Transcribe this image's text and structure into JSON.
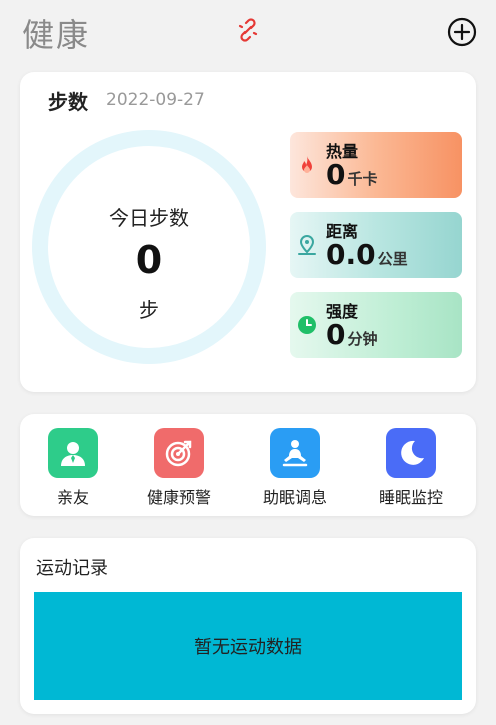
{
  "header": {
    "title": "健康"
  },
  "steps": {
    "label": "步数",
    "date": "2022-09-27",
    "today_label": "今日步数",
    "today_value": "0",
    "unit": "步"
  },
  "stats": {
    "heat": {
      "name": "热量",
      "value": "0",
      "unit": "千卡",
      "icon": "flame-icon"
    },
    "distance": {
      "name": "距离",
      "value": "0.0",
      "unit": "公里",
      "icon": "location-pin-icon"
    },
    "intensity": {
      "name": "强度",
      "value": "0",
      "unit": "分钟",
      "icon": "clock-icon"
    }
  },
  "features": [
    {
      "label": "亲友",
      "icon": "person-icon",
      "color": "#2ecc8a"
    },
    {
      "label": "健康预警",
      "icon": "target-icon",
      "color": "#f06b6b"
    },
    {
      "label": "助眠调息",
      "icon": "meditation-icon",
      "color": "#2a9df4"
    },
    {
      "label": "睡眠监控",
      "icon": "moon-icon",
      "color": "#4a6cf7"
    }
  ],
  "record": {
    "title": "运动记录",
    "empty_text": "暂无运动数据"
  },
  "colors": {
    "accent": "#00b8d4",
    "ring": "#e3f6fb"
  }
}
